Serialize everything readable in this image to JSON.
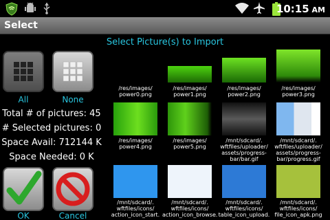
{
  "status_bar": {
    "time": "10:15",
    "ampm": "AM",
    "icons": [
      "shield-icon",
      "android-bug-icon",
      "usb-icon",
      "wifi-icon",
      "airplane-icon",
      "battery-icon"
    ]
  },
  "title_bar": {
    "title": "Select"
  },
  "left_panel": {
    "all_label": "All",
    "none_label": "None",
    "total_pictures": "Total # of pictures: 45",
    "selected_pictures": "# Selected pictures: 0",
    "space_avail": "Space Avail: 712144 K",
    "space_needed": "Space Needed: 0 K",
    "ok_label": "OK",
    "cancel_label": "Cancel"
  },
  "grid": {
    "header": "Select Picture(s) to Import",
    "items": [
      {
        "caption": "/res/images/\npower0.png",
        "thumb": "power0"
      },
      {
        "caption": "/res/images/\npower1.png",
        "thumb": "power1"
      },
      {
        "caption": "/res/images/\npower2.png",
        "thumb": "power2"
      },
      {
        "caption": "/res/images/\npower3.png",
        "thumb": "power3"
      },
      {
        "caption": "/res/images/\npower4.png",
        "thumb": "power4"
      },
      {
        "caption": "/res/images/\npower5.png",
        "thumb": "power5"
      },
      {
        "caption": "/mnt/sdcard/.\nwftfiles/uploader/\nassets/progress-\nbar/bar.gif",
        "thumb": "bar"
      },
      {
        "caption": "/mnt/sdcard/.\nwftfiles/uploader/\nassets/progress-\nbar/progress.gif",
        "thumb": "progress"
      },
      {
        "caption": "/mnt/sdcard/.\nwftfiles/icons/\naction_icon_start.",
        "thumb": "blue"
      },
      {
        "caption": "/mnt/sdcard/.\nwftfiles/icons/\naction_icon_browse.",
        "thumb": "lightblue"
      },
      {
        "caption": "/mnt/sdcard/.\nwftfiles/icons/\ntable_icon_upload.",
        "thumb": "blue2"
      },
      {
        "caption": "/mnt/sdcard/.\nwftfiles/icons/\nfile_icon_apk.png",
        "thumb": "olive"
      }
    ]
  }
}
